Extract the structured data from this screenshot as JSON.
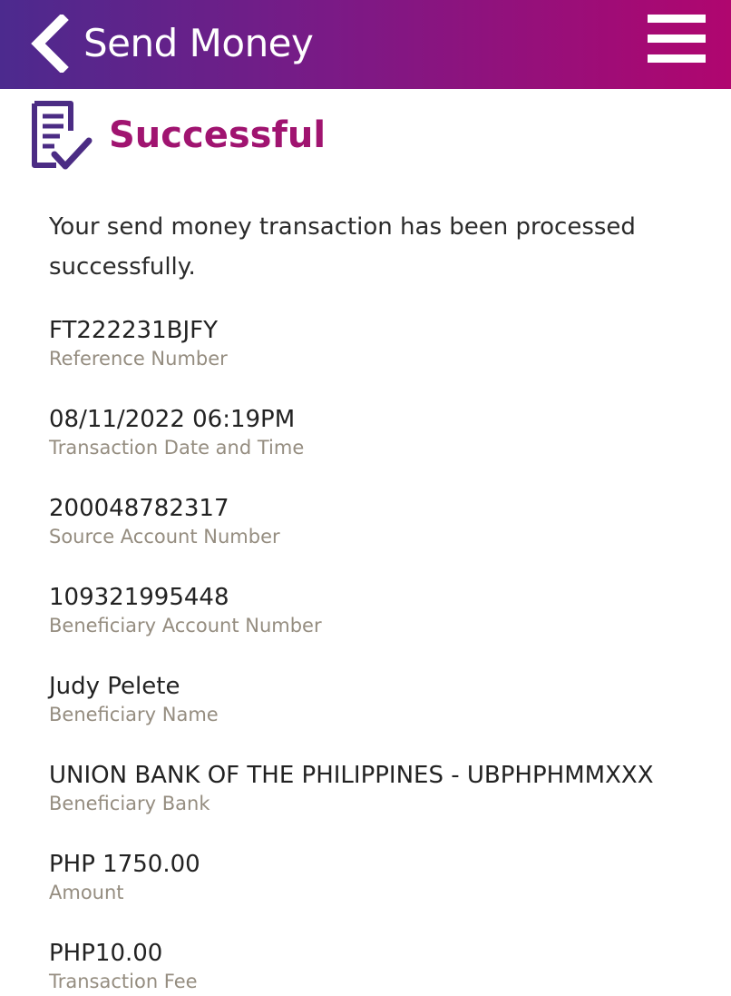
{
  "header": {
    "title": "Send Money",
    "back_icon": "chevron-left-icon",
    "menu_icon": "hamburger-menu-icon",
    "gradient_start": "#4c2a8e",
    "gradient_end": "#b0066f"
  },
  "status": {
    "icon": "receipt-check-icon",
    "title": "Successful",
    "title_color": "#a01470"
  },
  "message": "Your send money transaction has been processed successfully.",
  "details": [
    {
      "value": "FT222231BJFY",
      "label": "Reference Number"
    },
    {
      "value": "08/11/2022 06:19PM",
      "label": "Transaction Date and Time"
    },
    {
      "value": "200048782317",
      "label": "Source Account Number"
    },
    {
      "value": "109321995448",
      "label": "Beneficiary Account Number"
    },
    {
      "value": "Judy Pelete",
      "label": "Beneficiary Name"
    },
    {
      "value": "UNION BANK OF THE PHILIPPINES - UBPHPHMMXXX",
      "label": "Beneficiary Bank"
    },
    {
      "value": "PHP 1750.00",
      "label": "Amount"
    },
    {
      "value": "PHP10.00",
      "label": "Transaction Fee"
    }
  ]
}
